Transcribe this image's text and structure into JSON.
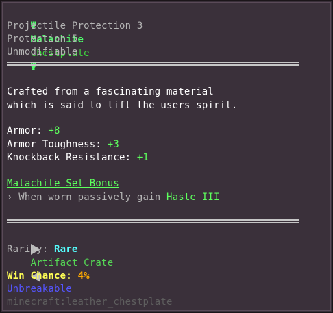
{
  "title": {
    "icon_left": "Ψ",
    "name_part1": "Malachite",
    "name_part2": "Chestplate",
    "icon_right": "Ψ"
  },
  "enchantments": [
    "Projectile Protection 3",
    "Protection 5",
    "Unmodifiable"
  ],
  "description": [
    "Crafted from a fascinating material",
    "which is said to lift the users spirit."
  ],
  "stats": [
    {
      "label": "Armor:",
      "value": "+8"
    },
    {
      "label": "Armor Toughness:",
      "value": "+3"
    },
    {
      "label": "Knockback Resistance:",
      "value": "+1"
    }
  ],
  "set_bonus": {
    "title": "Malachite Set Bonus",
    "prefix": "›",
    "text": "When worn passively gain",
    "effect": "Haste III"
  },
  "crate": {
    "name": "Artifact Crate",
    "rarity_label": "Rarity:",
    "rarity_value": "Rare"
  },
  "win_chance": {
    "label": "Win Chance:",
    "value": "4%"
  },
  "unbreakable": "Unbreakable",
  "item_id": "minecraft:leather_chestplate",
  "colors": {
    "background": "#3a303a",
    "green": "#5dff5d",
    "cyan": "#55ffff",
    "yellow": "#ffff55",
    "orange": "#ffaa00",
    "blue": "#5555ff",
    "gray": "#b5b5b5"
  }
}
